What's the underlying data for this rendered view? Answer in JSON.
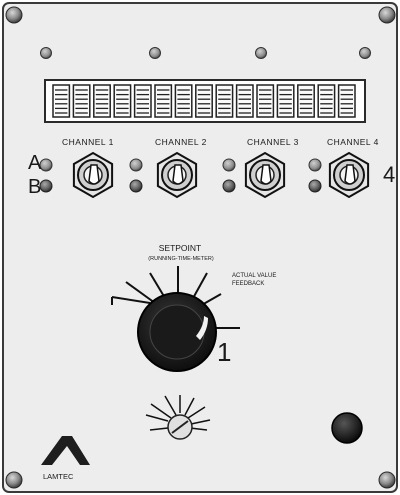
{
  "panel": {
    "channels": [
      "CHANNEL 1",
      "CHANNEL 2",
      "CHANNEL 3",
      "CHANNEL 4"
    ],
    "switch_a_label": "A",
    "switch_b_label": "B",
    "channel_4_number": "4",
    "setpoint_title": "SETPOINT",
    "setpoint_subtitle": "(RUNNING-TIME-METER)",
    "actual_value_line1": "ACTUAL VALUE",
    "actual_value_line2": "FEEDBACK",
    "selector_number": "1",
    "brand": "LAMTEC",
    "display_segments": 15
  },
  "colors": {
    "panel_face": "#ededed",
    "panel_border": "#3a3a3a",
    "led_off": "#9a9a9a",
    "knob": "#1c1c1c"
  }
}
